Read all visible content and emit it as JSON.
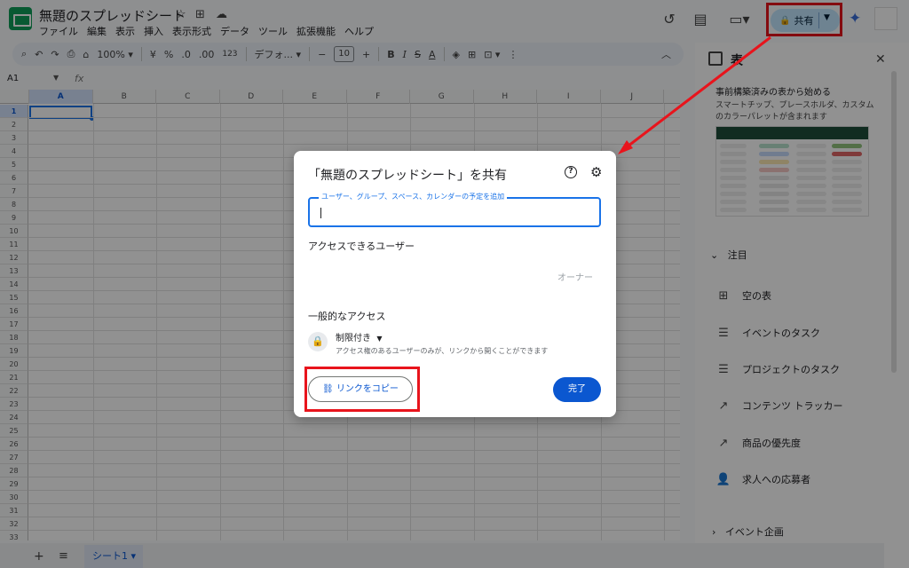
{
  "app": {
    "doc_title": "無題のスプレッドシート",
    "menu": [
      "ファイル",
      "編集",
      "表示",
      "挿入",
      "表示形式",
      "データ",
      "ツール",
      "拡張機能",
      "ヘルプ"
    ],
    "share_label": "共有"
  },
  "toolbar": {
    "zoom": "100%",
    "currency": "¥",
    "percent": "%",
    "dec_decrease": ".0",
    "dec_increase": ".00",
    "number_format": "123",
    "font": "デフォ...",
    "font_size": "10",
    "bold": "B",
    "italic": "I",
    "strike": "S",
    "text_color": "A"
  },
  "formula_bar": {
    "cell_ref": "A1",
    "fx": "fx"
  },
  "grid": {
    "columns": [
      "A",
      "B",
      "C",
      "D",
      "E",
      "F",
      "G",
      "H",
      "I",
      "J"
    ],
    "rows": [
      "1",
      "2",
      "3",
      "4",
      "5",
      "6",
      "7",
      "8",
      "9",
      "10",
      "11",
      "12",
      "13",
      "14",
      "15",
      "16",
      "17",
      "18",
      "19",
      "20",
      "21",
      "22",
      "23",
      "24",
      "25",
      "26",
      "27",
      "28",
      "29",
      "30",
      "31",
      "32",
      "33"
    ]
  },
  "sheet_tab": "シート1",
  "side_panel": {
    "title": "表",
    "subtitle": "事前構築済みの表から始める",
    "description": "スマートチップ、プレースホルダ、カスタムのカラーパレットが含まれます",
    "featured_label": "注目",
    "items": [
      {
        "label": "空の表",
        "icon": "table-icon"
      },
      {
        "label": "イベントのタスク",
        "icon": "checklist-icon"
      },
      {
        "label": "プロジェクトのタスク",
        "icon": "checklist-icon"
      },
      {
        "label": "コンテンツ トラッカー",
        "icon": "trend-icon"
      },
      {
        "label": "商品の優先度",
        "icon": "trend-icon"
      },
      {
        "label": "求人への応募者",
        "icon": "person-icon"
      }
    ],
    "event_planning": "イベント企画"
  },
  "dialog": {
    "title": "「無題のスプレッドシート」を共有",
    "input_label": "ユーザー、グループ、スペース、カレンダーの予定を追加",
    "access_users": "アクセスできるユーザー",
    "owner": "オーナー",
    "general_access": "一般的なアクセス",
    "restricted": "制限付き",
    "restricted_desc": "アクセス権のあるユーザーのみが、リンクから開くことができます",
    "copy_link": "リンクをコピー",
    "done": "完了"
  },
  "colors": {
    "accent": "#0b57d0",
    "share_bg": "#c2e7ff",
    "annotation_red": "#e8141c",
    "sheets_green": "#0f9d58"
  }
}
